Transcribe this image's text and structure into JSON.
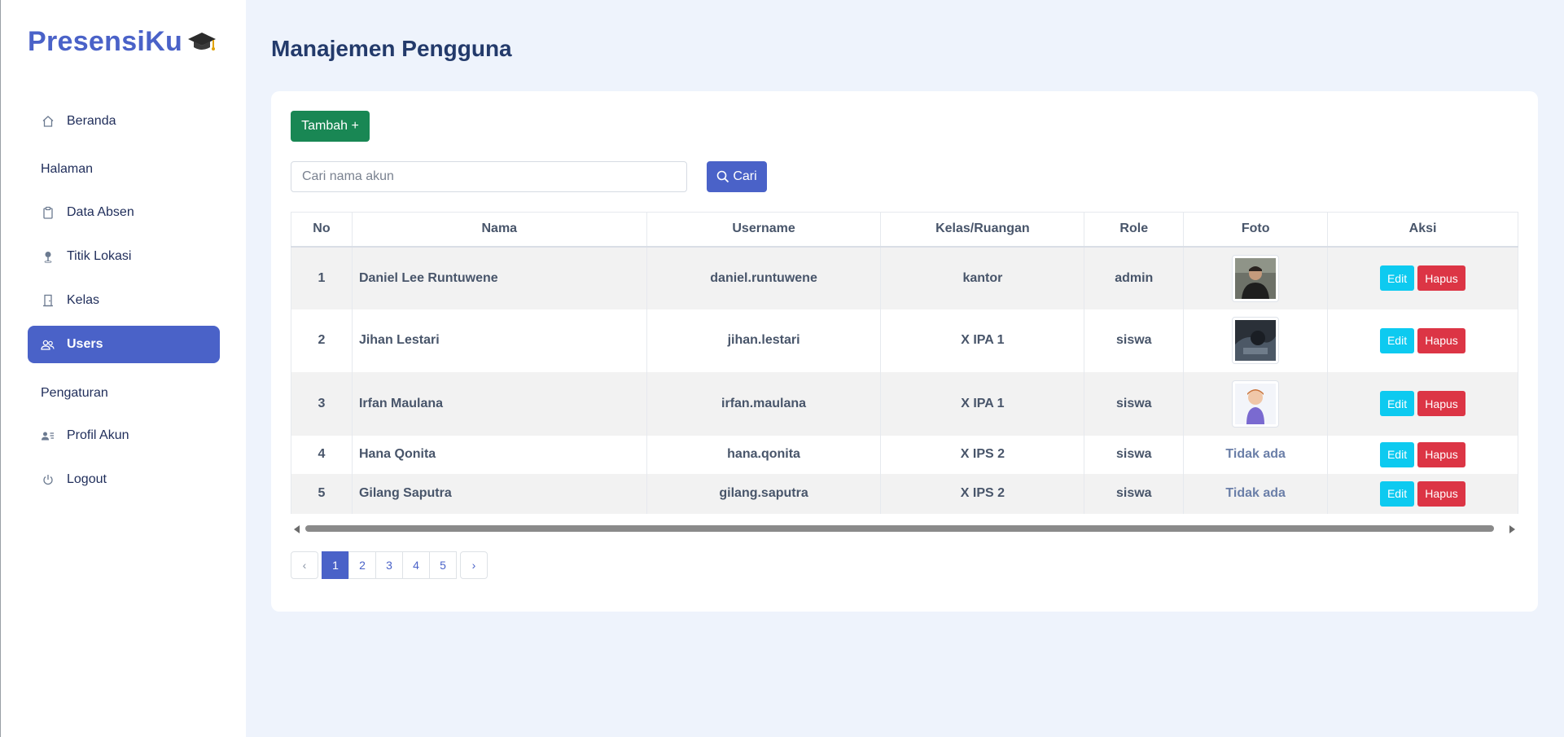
{
  "brand": {
    "name": "PresensiKu",
    "icon": "graduation-cap-icon"
  },
  "sidebar": {
    "items": [
      {
        "label": "Beranda",
        "icon": "home-icon"
      },
      {
        "label": "Data Absen",
        "icon": "clipboard-icon"
      },
      {
        "label": "Titik Lokasi",
        "icon": "map-pin-icon"
      },
      {
        "label": "Kelas",
        "icon": "door-icon"
      },
      {
        "label": "Users",
        "icon": "users-icon",
        "active": true
      },
      {
        "label": "Profil Akun",
        "icon": "person-card-icon"
      },
      {
        "label": "Logout",
        "icon": "power-icon"
      }
    ],
    "sections": {
      "halaman": "Halaman",
      "pengaturan": "Pengaturan"
    }
  },
  "page": {
    "title": "Manajemen Pengguna"
  },
  "toolbar": {
    "add_label": "Tambah +",
    "search_placeholder": "Cari nama akun",
    "search_label": "Cari"
  },
  "table": {
    "headers": [
      "No",
      "Nama",
      "Username",
      "Kelas/Ruangan",
      "Role",
      "Foto",
      "Aksi"
    ],
    "rows": [
      {
        "no": "1",
        "nama": "Daniel Lee Runtuwene",
        "username": "daniel.runtuwene",
        "kelas": "kantor",
        "role": "admin",
        "foto": "photo"
      },
      {
        "no": "2",
        "nama": "Jihan Lestari",
        "username": "jihan.lestari",
        "kelas": "X IPA 1",
        "role": "siswa",
        "foto": "photo"
      },
      {
        "no": "3",
        "nama": "Irfan Maulana",
        "username": "irfan.maulana",
        "kelas": "X IPA 1",
        "role": "siswa",
        "foto": "photo"
      },
      {
        "no": "4",
        "nama": "Hana Qonita",
        "username": "hana.qonita",
        "kelas": "X IPS 2",
        "role": "siswa",
        "foto": "Tidak ada"
      },
      {
        "no": "5",
        "nama": "Gilang Saputra",
        "username": "gilang.saputra",
        "kelas": "X IPS 2",
        "role": "siswa",
        "foto": "Tidak ada"
      }
    ],
    "edit_label": "Edit",
    "delete_label": "Hapus"
  },
  "pagination": {
    "prev": "‹",
    "next": "›",
    "pages": [
      "1",
      "2",
      "3",
      "4",
      "5"
    ],
    "current": "1"
  },
  "colors": {
    "primary": "#4a62c8",
    "success": "#198754",
    "info": "#0dcaf0",
    "danger": "#dc3545",
    "background": "#eef3fc"
  }
}
